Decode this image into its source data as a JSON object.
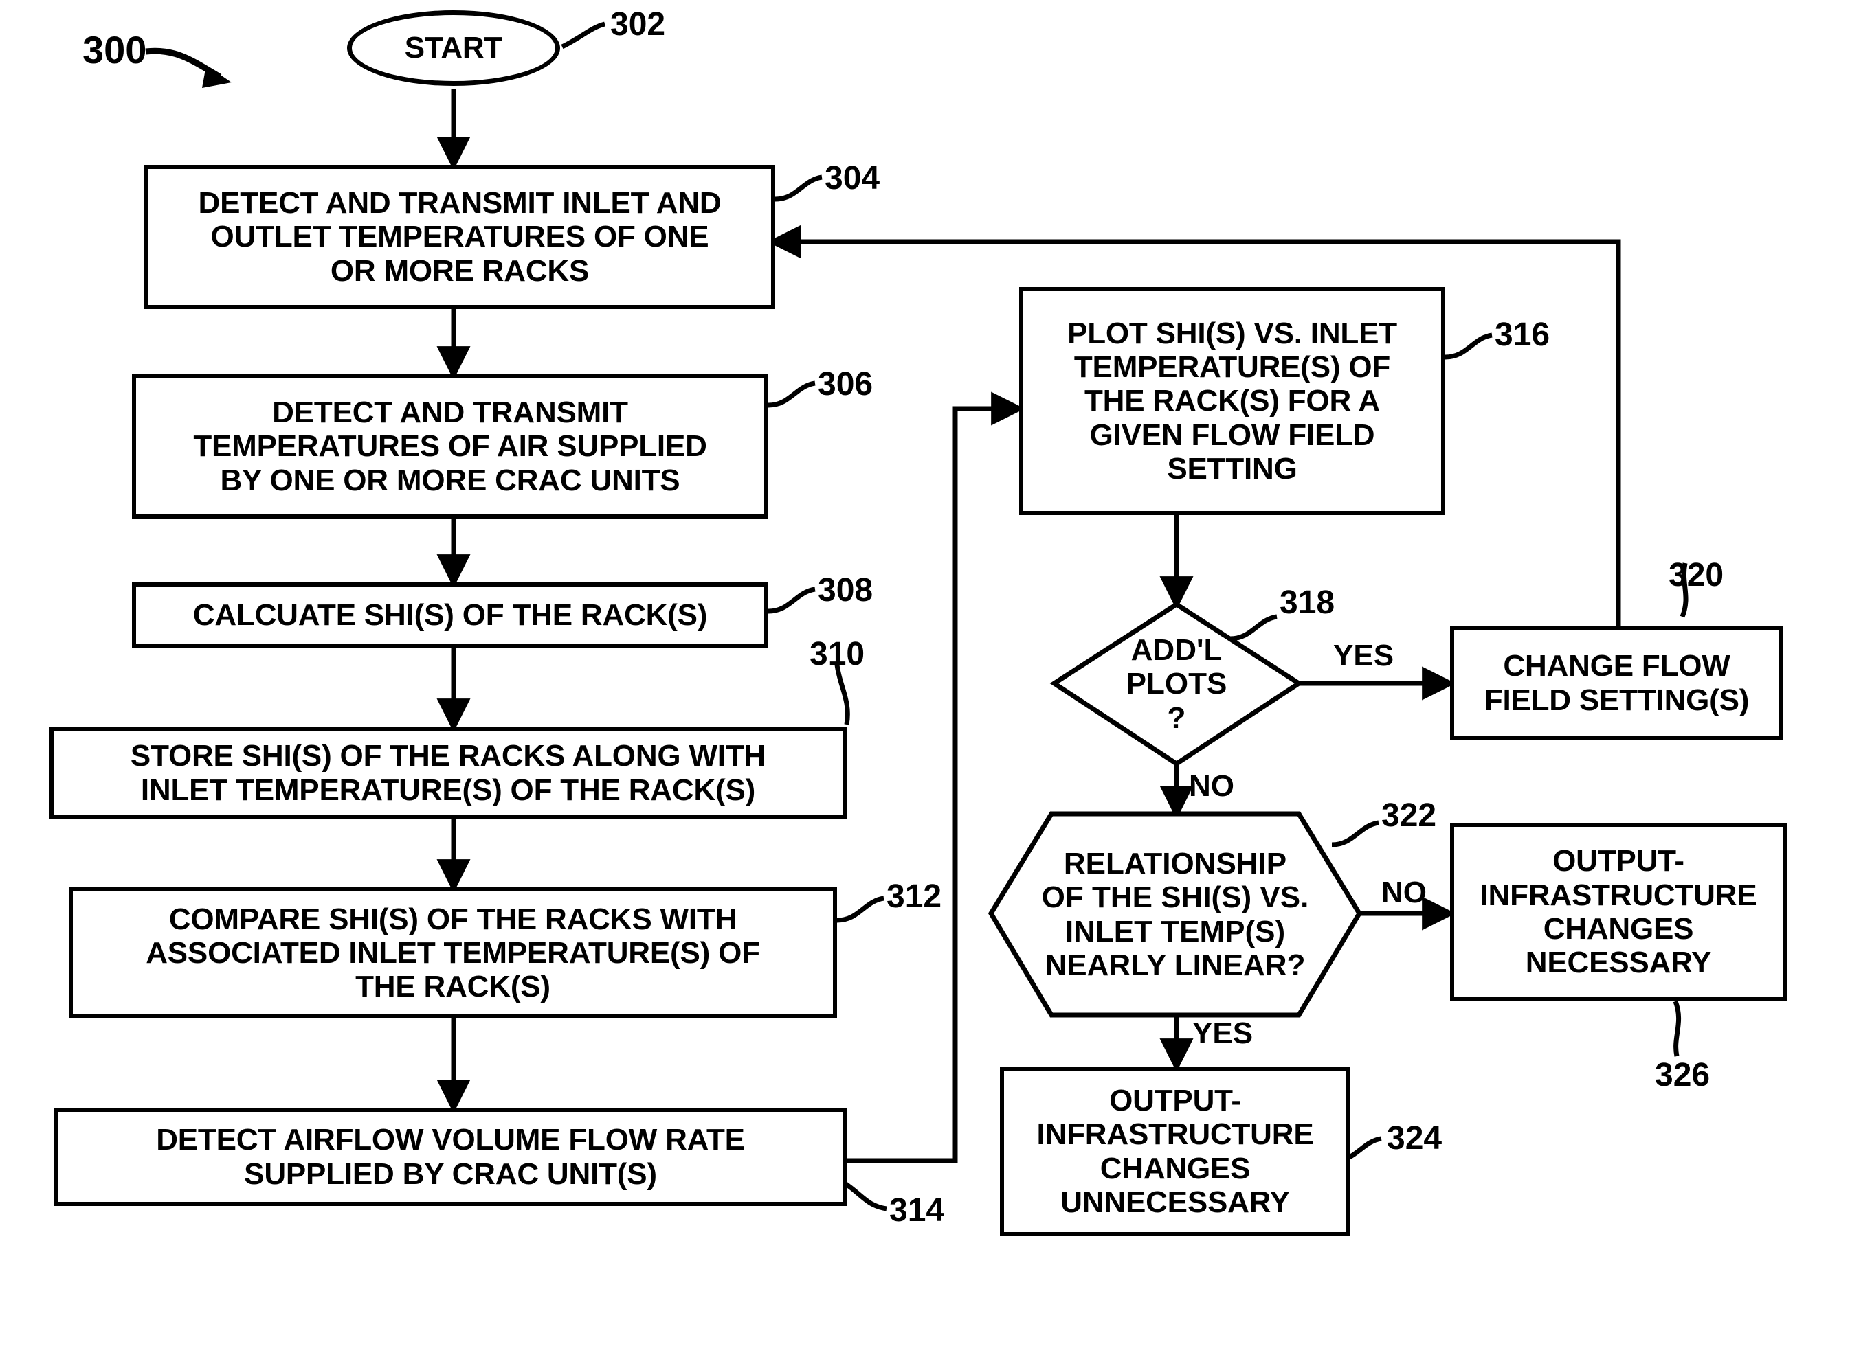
{
  "figure": {
    "reference_numeral": "300",
    "type": "flowchart"
  },
  "nodes": {
    "start": {
      "label": "START",
      "ref": "302"
    },
    "n304": {
      "label": "DETECT AND TRANSMIT INLET AND\nOUTLET TEMPERATURES OF ONE\nOR MORE RACKS",
      "ref": "304"
    },
    "n306": {
      "label": "DETECT AND TRANSMIT\nTEMPERATURES OF AIR SUPPLIED\nBY ONE OR MORE CRAC UNITS",
      "ref": "306"
    },
    "n308": {
      "label": "CALCUATE SHI(S) OF THE RACK(S)",
      "ref": "308"
    },
    "n310": {
      "label": "STORE SHI(S) OF THE RACKS ALONG WITH\nINLET TEMPERATURE(S) OF THE RACK(S)",
      "ref": "310"
    },
    "n312": {
      "label": "COMPARE SHI(S) OF THE RACKS WITH\nASSOCIATED INLET TEMPERATURE(S) OF\nTHE RACK(S)",
      "ref": "312"
    },
    "n314": {
      "label": "DETECT AIRFLOW VOLUME FLOW RATE\nSUPPLIED BY CRAC UNIT(S)",
      "ref": "314"
    },
    "n316": {
      "label": "PLOT SHI(S) VS. INLET\nTEMPERATURE(S) OF\nTHE RACK(S) FOR A\nGIVEN FLOW FIELD\nSETTING",
      "ref": "316"
    },
    "n318": {
      "label": "ADD'L\nPLOTS\n?",
      "ref": "318"
    },
    "n320": {
      "label": "CHANGE FLOW\nFIELD SETTING(S)",
      "ref": "320"
    },
    "n322": {
      "label": "RELATIONSHIP\nOF THE SHI(S) VS.\nINLET TEMP(S)\nNEARLY LINEAR?",
      "ref": "322"
    },
    "n324": {
      "label": "OUTPUT-\nINFRASTRUCTURE\nCHANGES\nUNNECESSARY",
      "ref": "324"
    },
    "n326": {
      "label": "OUTPUT-\nINFRASTRUCTURE\nCHANGES\nNECESSARY",
      "ref": "326"
    }
  },
  "edge_labels": {
    "addl_plots_yes": "YES",
    "addl_plots_no": "NO",
    "linear_no": "NO",
    "linear_yes": "YES"
  },
  "colors": {
    "ink": "#000000",
    "paper": "#ffffff"
  }
}
